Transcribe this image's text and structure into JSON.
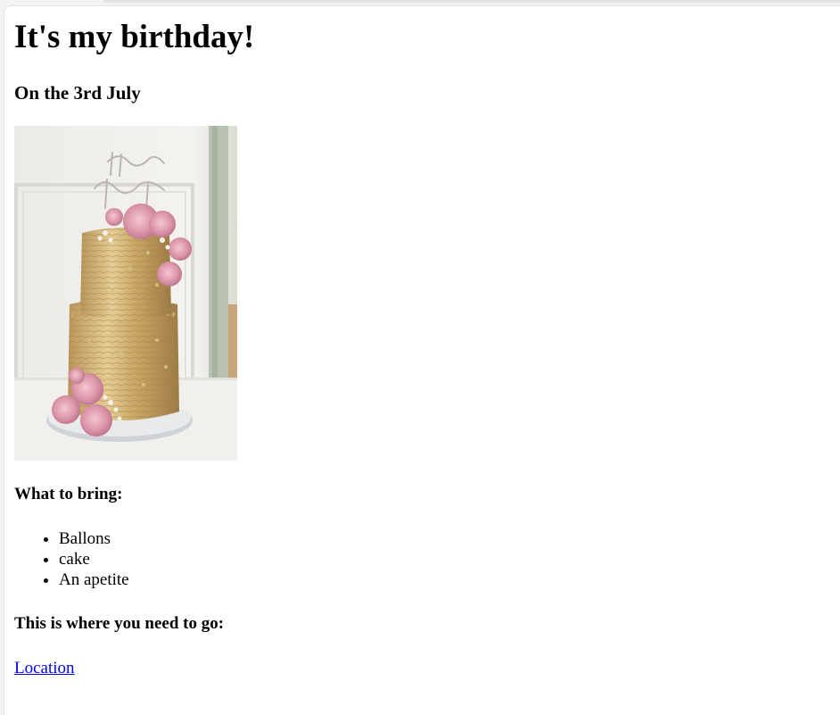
{
  "page": {
    "heading": "It's my birthday!",
    "date_line": "On the 3rd July",
    "image": {
      "icon": "birthday-cake-photo",
      "topper_text": "Happy Birthday"
    },
    "bring": {
      "title": "What to bring:",
      "items": [
        "Ballons",
        "cake",
        "An apetite"
      ]
    },
    "go": {
      "title": "This is where you need to go:",
      "link_label": "Location"
    }
  }
}
